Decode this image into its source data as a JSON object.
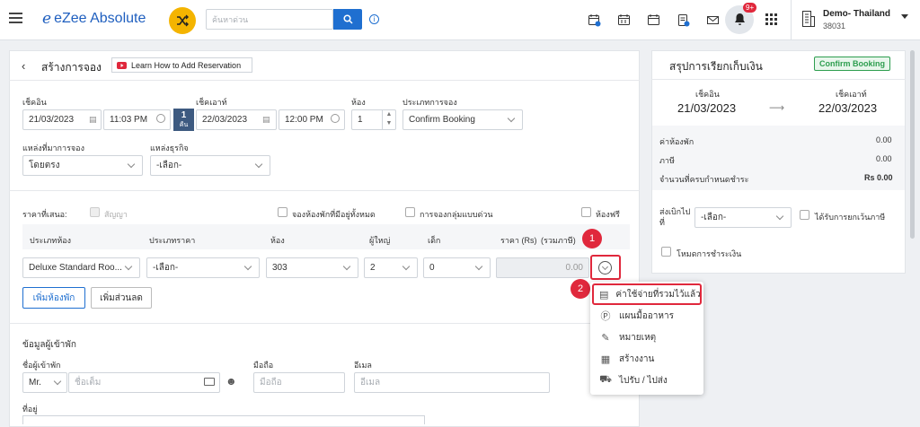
{
  "app": {
    "logo_letter": "e",
    "brand": "eZee Absolute"
  },
  "search": {
    "placeholder": "ค้นหาด่วน"
  },
  "notifications": {
    "badge": "9+"
  },
  "property": {
    "name": "Demo- Thailand",
    "code": "38031"
  },
  "page": {
    "title": "สร้างการจอง",
    "help_label": "Learn How to Add Reservation"
  },
  "form": {
    "checkin_label": "เช็คอิน",
    "checkin_date": "21/03/2023",
    "checkin_time": "11:03 PM",
    "nights_value": "1",
    "nights_unit": "คืน",
    "checkout_label": "เช็คเอาท์",
    "checkout_date": "22/03/2023",
    "checkout_time": "12:00 PM",
    "rooms_label": "ห้อง",
    "rooms_value": "1",
    "booking_type_label": "ประเภทการจอง",
    "booking_type_value": "Confirm Booking",
    "source_label": "แหล่งที่มาการจอง",
    "source_value": "โดยตรง",
    "business_label": "แหล่งธุรกิจ",
    "business_value": "-เลือก-"
  },
  "rates": {
    "offer_label": "ราคาที่เสนอ:",
    "contract_label": "สัญญา",
    "book_all_label": "จองห้องพักที่มีอยู่ทั้งหมด",
    "group_label": "การจองกลุ่มแบบด่วน",
    "free_label": "ห้องฟรี",
    "headers": [
      "ประเภทห้อง",
      "ประเภทราคา",
      "ห้อง",
      "ผู้ใหญ่",
      "เด็ก",
      "ราคา (Rs)",
      "(รวมภาษี)"
    ],
    "row": {
      "room_type": "Deluxe Standard Roo...",
      "rate_type": "-เลือก-",
      "room": "303",
      "adult": "2",
      "child": "0",
      "price": "0.00"
    },
    "add_room": "เพิ่มห้องพัก",
    "add_discount": "เพิ่มส่วนลด"
  },
  "guest": {
    "section": "ข้อมูลผู้เข้าพัก",
    "name_label": "ชื่อผู้เข้าพัก",
    "title_value": "Mr.",
    "name_placeholder": "ชื่อเต็ม",
    "mobile_label": "มือถือ",
    "mobile_placeholder": "มือถือ",
    "email_label": "อีเมล",
    "email_placeholder": "อีเมล",
    "address_label": "ที่อยู่"
  },
  "menu": {
    "items": [
      "ค่าใช้จ่ายที่รวมไว้แล้ว",
      "แผนมื้ออาหาร",
      "หมายเหตุ",
      "สร้างงาน",
      "ไปรับ / ไปส่ง"
    ]
  },
  "markers": [
    "1",
    "2"
  ],
  "summary": {
    "title": "สรุปการเรียกเก็บเงิน",
    "badge": "Confirm Booking",
    "checkin_label": "เช็คอิน",
    "checkin_date": "21/03/2023",
    "checkout_label": "เช็คเอาท์",
    "checkout_date": "22/03/2023",
    "lines": [
      {
        "label": "ค่าห้องพัก",
        "value": "0.00"
      },
      {
        "label": "ภาษี",
        "value": "0.00"
      },
      {
        "label": "จำนวนที่ครบกำหนดชำระ",
        "value": "Rs 0.00"
      }
    ],
    "bill_to_label": "ส่งเบิกไปที่",
    "bill_to_value": "-เลือก-",
    "tax_exempt_label": "ได้รับการยกเว้นภาษี",
    "payment_mode_label": "โหมดการชำระเงิน"
  },
  "colors": {
    "accent": "#1f6fd0",
    "marker": "#e0283c",
    "green": "#2e9e4f"
  }
}
